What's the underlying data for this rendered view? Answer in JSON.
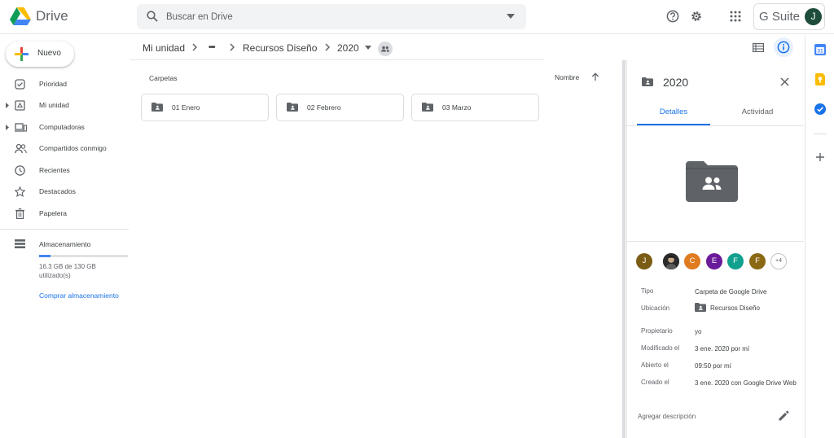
{
  "header": {
    "app_name": "Drive",
    "search_placeholder": "Buscar en Drive",
    "suite_label": "G Suite",
    "account_initial": "J"
  },
  "sidebar": {
    "new_label": "Nuevo",
    "items": [
      {
        "label": "Prioridad",
        "icon": "check-circle-icon"
      },
      {
        "label": "Mi unidad",
        "icon": "my-drive-icon"
      },
      {
        "label": "Computadoras",
        "icon": "computers-icon"
      },
      {
        "label": "Compartidos conmigo",
        "icon": "people-icon"
      },
      {
        "label": "Recientes",
        "icon": "clock-icon"
      },
      {
        "label": "Destacados",
        "icon": "star-icon"
      },
      {
        "label": "Papelera",
        "icon": "trash-icon"
      }
    ],
    "storage_label": "Almacenamiento",
    "storage_used_text": "16.3 GB de 130 GB utilizado(s)",
    "storage_fraction": 0.125,
    "buy_storage_label": "Comprar almacenamiento"
  },
  "breadcrumb": {
    "items": [
      "Mi unidad",
      "•••",
      "Recursos Diseño",
      "2020"
    ]
  },
  "main": {
    "section_label": "Carpetas",
    "sort_label": "Nombre",
    "folders": [
      {
        "name": "01 Enero"
      },
      {
        "name": "02 Febrero"
      },
      {
        "name": "03 Marzo"
      }
    ]
  },
  "details": {
    "title": "2020",
    "tabs": [
      "Detalles",
      "Actividad"
    ],
    "active_tab": "Detalles",
    "avatars": [
      {
        "initial": "J",
        "color": "#7b5c14"
      },
      {
        "initial": "",
        "color": "#2b2b2b"
      },
      {
        "initial": "C",
        "color": "#e07b1f"
      },
      {
        "initial": "E",
        "color": "#6a1b9a"
      },
      {
        "initial": "F",
        "color": "#12a08e"
      },
      {
        "initial": "F",
        "color": "#8b6914"
      }
    ],
    "more_avatars": "+4",
    "properties": {
      "type_key": "Tipo",
      "type_val": "Carpeta de Google Drive",
      "location_key": "Ubicación",
      "location_val": "Recursos Diseño",
      "owner_key": "Propietario",
      "owner_val": "yo",
      "modified_key": "Modificado el",
      "modified_val": "3 ene. 2020 por mí",
      "opened_key": "Abierto el",
      "opened_val": "09:50 por mí",
      "created_key": "Creado el",
      "created_val": "3 ene. 2020 con Google Drive Web"
    },
    "add_description": "Agregar descripción"
  },
  "colors": {
    "accent": "#1a73e8",
    "calendar": "#4285f4",
    "keep": "#fbbc04",
    "tasks": "#1a73e8"
  }
}
